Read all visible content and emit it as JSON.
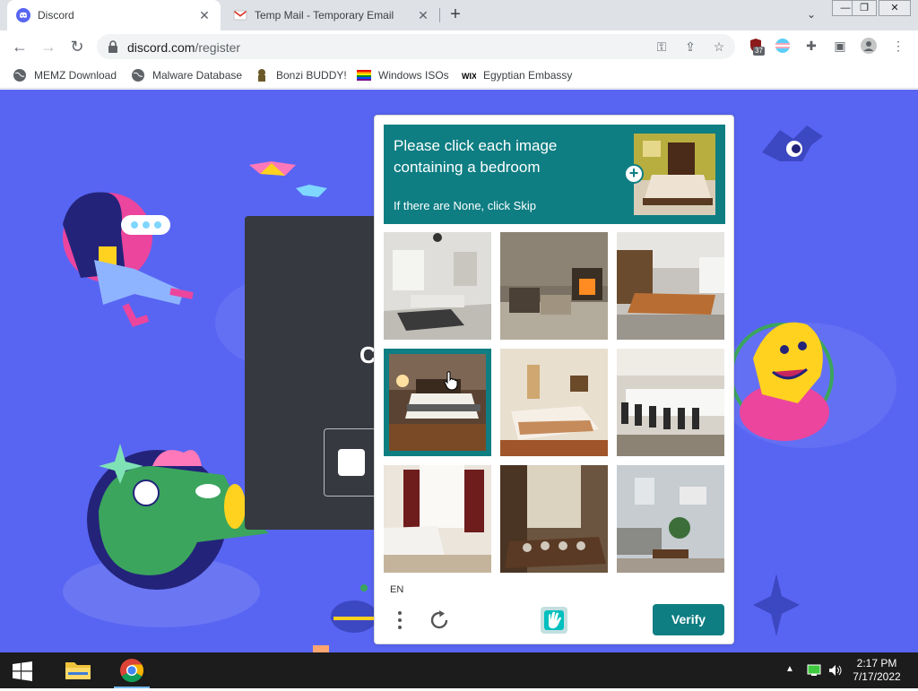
{
  "browser": {
    "tabs": [
      {
        "title": "Discord",
        "icon": "discord-icon",
        "active": true
      },
      {
        "title": "Temp Mail - Temporary Email",
        "icon": "gmail-icon",
        "active": false
      }
    ],
    "url_host": "discord.com",
    "url_path": "/register",
    "extension_badge": "37",
    "bookmarks": [
      {
        "label": "MEMZ Download",
        "icon": "globe-icon"
      },
      {
        "label": "Malware Database",
        "icon": "globe-icon"
      },
      {
        "label": "Bonzi BUDDY!",
        "icon": "bonzi-icon"
      },
      {
        "label": "Windows ISOs",
        "icon": "rainbow-flag-icon"
      },
      {
        "label": "Egyptian Embassy",
        "icon": "wix-icon"
      }
    ]
  },
  "captcha": {
    "prompt": "Please click each image containing a bedroom",
    "skip_hint": "If there are None, click Skip",
    "language": "EN",
    "verify_label": "Verify",
    "accent_color": "#0e7e83",
    "tiles": [
      {
        "label": "living room",
        "selected": false
      },
      {
        "label": "fireplace room",
        "selected": false
      },
      {
        "label": "conference room",
        "selected": false
      },
      {
        "label": "bedroom",
        "selected": true
      },
      {
        "label": "bedroom",
        "selected": false
      },
      {
        "label": "banquet hall",
        "selected": false
      },
      {
        "label": "bedroom",
        "selected": false
      },
      {
        "label": "dining room",
        "selected": false
      },
      {
        "label": "living room",
        "selected": false
      }
    ]
  },
  "page": {
    "background_color": "#5865f2",
    "card_letter": "C"
  },
  "taskbar": {
    "time": "2:17 PM",
    "date": "7/17/2022"
  }
}
